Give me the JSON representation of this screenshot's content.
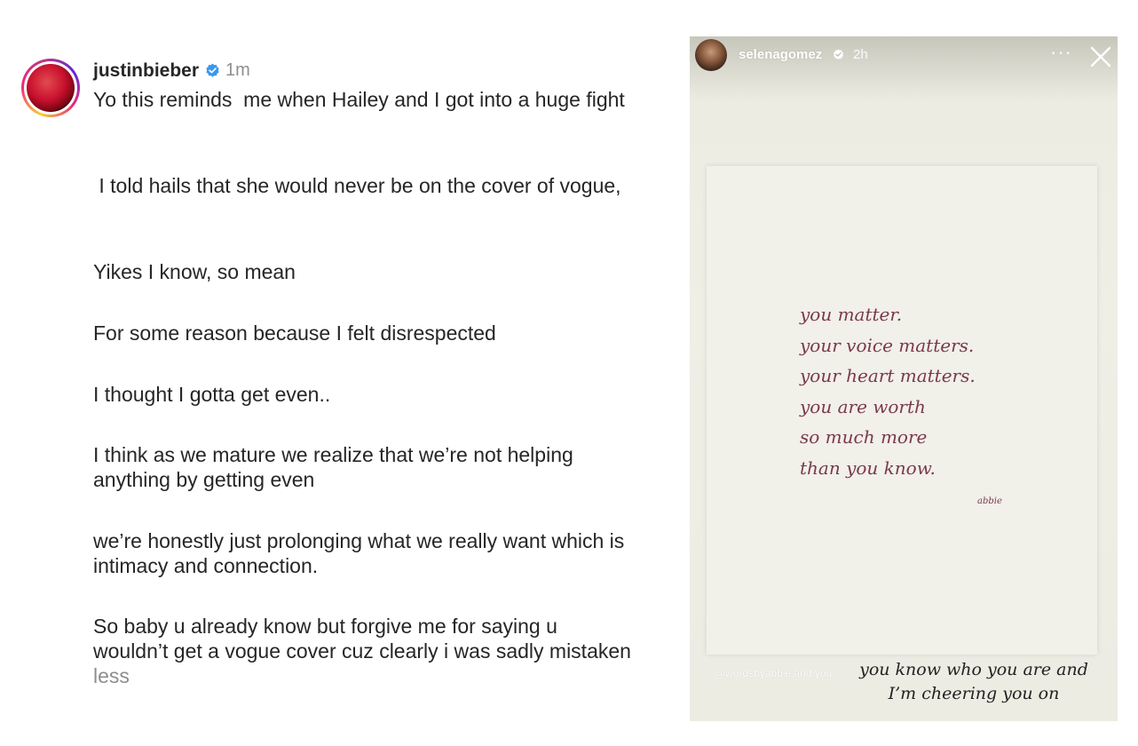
{
  "comment": {
    "username": "justinbieber",
    "time": "1m",
    "paragraphs": [
      "Yo this reminds  me when Hailey and I got into a huge fight",
      " I told hails that she would never be on the cover of vogue,",
      "Yikes I know, so mean",
      "For some reason because I felt disrespected",
      "I thought I gotta get even..",
      "I think as we mature we realize that we’re not helping anything by getting even",
      "we’re honestly just prolonging what we really want which is intimacy and connection.",
      "So baby u already know but forgive me for saying u wouldn’t get a vogue cover cuz clearly i was sadly mistaken "
    ],
    "less_label": "less"
  },
  "story": {
    "username": "selenagomez",
    "time": "2h",
    "more_label": "···",
    "card_lines": [
      "you matter.",
      "your voice matters.",
      "your heart matters.",
      "you are worth",
      "so much more",
      "than you know."
    ],
    "card_signature": "abbie",
    "mention_text": "@wordsbyabbie and you",
    "caption_lines": [
      "you know who you are and",
      "I’m cheering you on"
    ]
  },
  "colors": {
    "verified_blue": "#3897f0",
    "text_primary": "#262626",
    "text_secondary": "#8e8e8e",
    "handwriting": "#7a3a4a"
  },
  "icons": {
    "verified": "verified-badge-icon",
    "close": "close-icon",
    "more": "more-options-icon"
  }
}
